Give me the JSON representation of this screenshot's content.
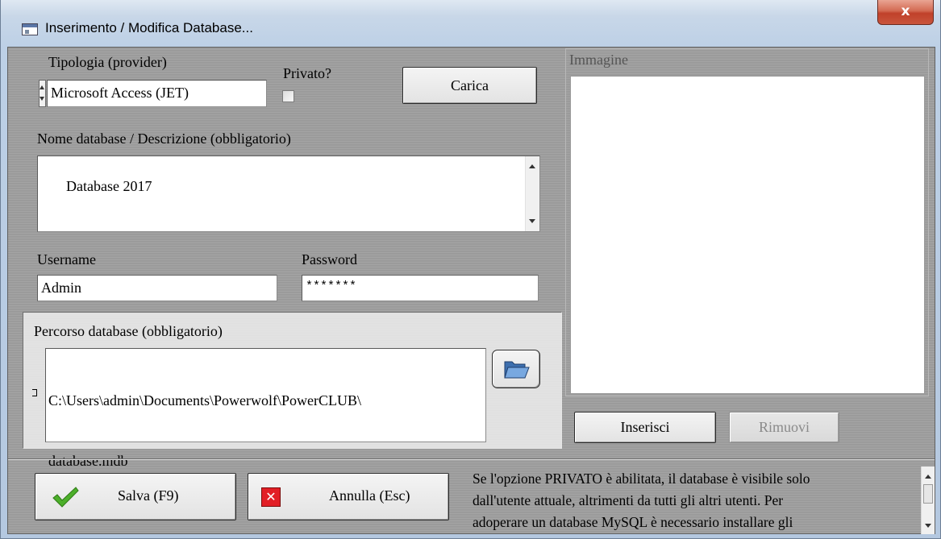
{
  "window": {
    "title": "Inserimento / Modifica Database...",
    "close_glyph": "x"
  },
  "provider": {
    "label": "Tipologia (provider)",
    "value": "Microsoft Access (JET)"
  },
  "privato": {
    "label": "Privato?",
    "checked": false
  },
  "carica_button": "Carica",
  "nome": {
    "label": "Nome database / Descrizione (obbligatorio)",
    "value": "Database 2017"
  },
  "username": {
    "label": "Username",
    "value": "Admin"
  },
  "password": {
    "label": "Password",
    "value": "*******"
  },
  "percorso": {
    "label": "Percorso database (obbligatorio)",
    "line1": "C:\\Users\\admin\\Documents\\Powerwolf\\PowerCLUB\\",
    "line2": "database.mdb"
  },
  "immagine": {
    "label": "Immagine",
    "inserisci": "Inserisci",
    "rimuovi": "Rimuovi"
  },
  "footer": {
    "salva": "Salva (F9)",
    "annulla": "Annulla (Esc)",
    "info_line1": "Se l'opzione PRIVATO è abilitata, il database è visibile solo",
    "info_line2": "dall'utente attuale, altrimenti da tutti gli altri utenti. Per",
    "info_line3": "adoperare un database MySQL è necessario installare gli"
  },
  "icons": {
    "title": "window-app-icon",
    "folder": "folder-open-icon",
    "check": "green-check-icon",
    "cancel": "red-x-icon"
  },
  "colors": {
    "client_bg": "#9e9e9e",
    "close_red": "#c9553c",
    "check_green": "#4caf2a",
    "cancel_red": "#e21f26"
  }
}
